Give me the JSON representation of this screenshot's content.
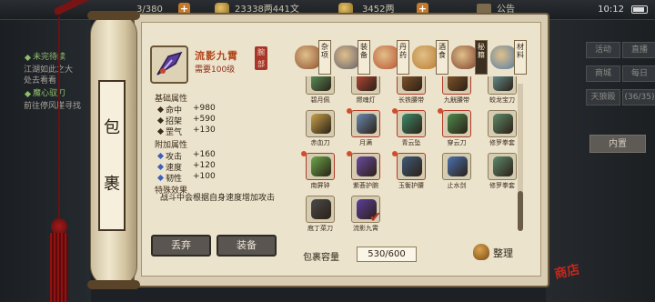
{
  "topbar": {
    "stat1": "3/380",
    "stat2": "23338两441文",
    "stat3": "3452两",
    "notice": "公告",
    "time": "10:12"
  },
  "quests": [
    {
      "title": "未完待续",
      "desc1": "江湖如此之大",
      "desc2": "处去看看"
    },
    {
      "title": "魔心驭刀",
      "desc1": "前往停风崖寻找"
    }
  ],
  "right_menu": {
    "buttons": [
      "活动",
      "直播",
      "商城",
      "每日",
      "天狼殿"
    ],
    "count_text": "(36/35)",
    "inner": "内置"
  },
  "roller": {
    "label_chars": [
      "包",
      "裹"
    ]
  },
  "item": {
    "icon": "purple-blade-icon",
    "name": "流影九霄",
    "requirement": "需要100级",
    "seal": "腕部",
    "base_title": "基础属性",
    "base_attrs": [
      {
        "name": "命中",
        "value": "+980"
      },
      {
        "name": "招架",
        "value": "+590"
      },
      {
        "name": "罡气",
        "value": "+130"
      }
    ],
    "extra_title": "附加属性",
    "extra_attrs": [
      {
        "name": "攻击",
        "value": "+160"
      },
      {
        "name": "速度",
        "value": "+120"
      },
      {
        "name": "韧性",
        "value": "+100"
      }
    ],
    "special_title": "特殊效果",
    "special_desc": "战斗中会根据自身速度增加攻击"
  },
  "actions": {
    "discard": "丢弃",
    "equip": "装备"
  },
  "tabs": [
    {
      "label": "杂项",
      "icon": "misc-icon"
    },
    {
      "label": "装备",
      "icon": "equipment-icon"
    },
    {
      "label": "丹药",
      "icon": "pill-icon"
    },
    {
      "label": "酒食",
      "icon": "food-icon"
    },
    {
      "label": "秘籍",
      "icon": "book-icon"
    },
    {
      "label": "材料",
      "icon": "material-icon"
    }
  ],
  "grid": [
    {
      "name": "碧月佩",
      "icon": "jade-pendant-icon"
    },
    {
      "name": "燃魂灯",
      "icon": "lamp-icon"
    },
    {
      "name": "长铁腰带",
      "icon": "belt-icon"
    },
    {
      "name": "九觥腰带",
      "icon": "belt-icon"
    },
    {
      "name": "蛟龙宝刀",
      "icon": "blade-icon"
    },
    {
      "name": "赤血刀",
      "icon": "saber-icon"
    },
    {
      "name": "月满",
      "icon": "spear-icon"
    },
    {
      "name": "青云坠",
      "icon": "pendant-icon"
    },
    {
      "name": "穿云刀",
      "icon": "sword-icon"
    },
    {
      "name": "修罗拳套",
      "icon": "gauntlet-icon"
    },
    {
      "name": "南屏钟",
      "icon": "bell-icon"
    },
    {
      "name": "紫荟护腕",
      "icon": "bracer-icon"
    },
    {
      "name": "玉衡护腰",
      "icon": "waist-icon"
    },
    {
      "name": "止水剑",
      "icon": "blue-sword-icon"
    },
    {
      "name": "修罗拳套",
      "icon": "gauntlet-icon"
    },
    {
      "name": "庖丁菜刀",
      "icon": "cleaver-icon"
    },
    {
      "name": "流影九霄",
      "icon": "purple-blade-icon"
    }
  ],
  "capacity": {
    "label": "包裹容量",
    "value": "530/600"
  },
  "arrange": {
    "label": "整理"
  },
  "stamp": "商店"
}
